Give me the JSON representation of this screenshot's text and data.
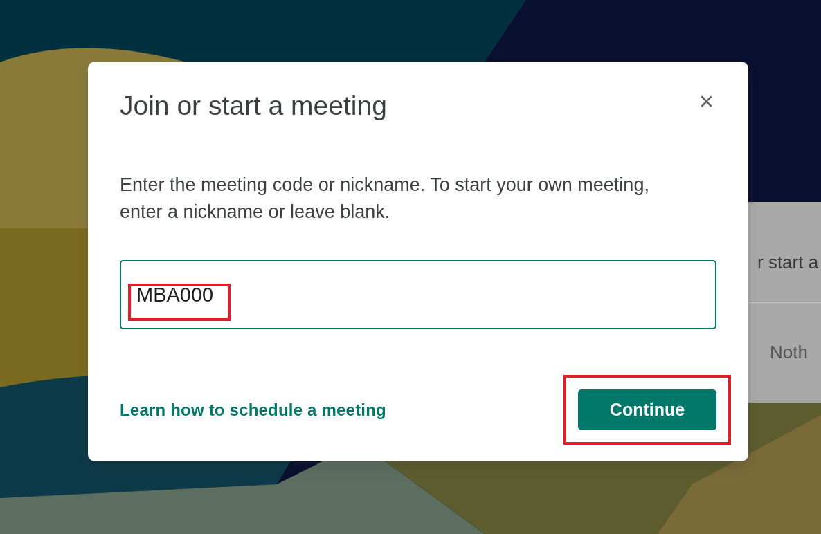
{
  "background_panel": {
    "heading": "r start a",
    "text": "Noth"
  },
  "dialog": {
    "title": "Join or start a meeting",
    "close": "×",
    "description": "Enter the meeting code or nickname. To start your own meeting, enter a nickname or leave blank.",
    "field": {
      "value": "MBA000",
      "focused": true,
      "highlighted": true
    },
    "link": "Learn how to schedule a meeting",
    "button": {
      "label": "Continue",
      "highlighted": true
    }
  }
}
